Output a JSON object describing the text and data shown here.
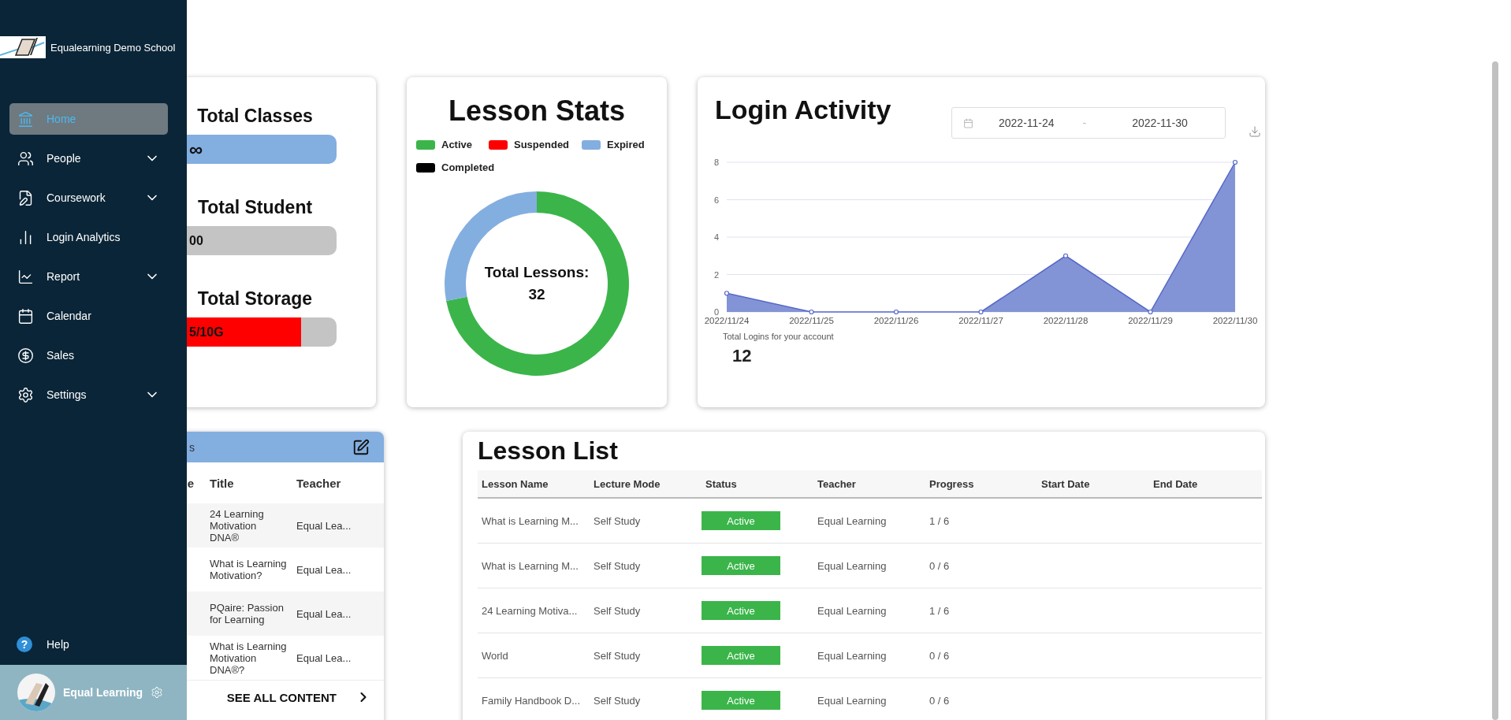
{
  "sidebar": {
    "school_name": "Equalearning Demo School",
    "nav_items": [
      {
        "label": "Home",
        "selected": true,
        "expandable": false
      },
      {
        "label": "People",
        "selected": false,
        "expandable": true
      },
      {
        "label": "Coursework",
        "selected": false,
        "expandable": true
      },
      {
        "label": "Login Analytics",
        "selected": false,
        "expandable": false
      },
      {
        "label": "Report",
        "selected": false,
        "expandable": true
      },
      {
        "label": "Calendar",
        "selected": false,
        "expandable": false
      },
      {
        "label": "Sales",
        "selected": false,
        "expandable": false
      },
      {
        "label": "Settings",
        "selected": false,
        "expandable": true
      }
    ],
    "help_icon": "?",
    "help": "Help",
    "user": {
      "name": "Equal Learning"
    }
  },
  "stats": {
    "items": [
      {
        "title": "Total Classes",
        "value": "∞",
        "color": "#83aee0"
      },
      {
        "title": "Total Student",
        "value": "00",
        "color": "#c4c4c4"
      },
      {
        "title": "Total Storage",
        "value": "5/10G",
        "color": "#ff0000",
        "level": 0.81
      }
    ]
  },
  "lesson_stats": {
    "title": "Lesson Stats",
    "legend": [
      {
        "label": "Active",
        "color": "#3bb54a"
      },
      {
        "label": "Suspended",
        "color": "#ff0000"
      },
      {
        "label": "Expired",
        "color": "#83aee0"
      },
      {
        "label": "Completed",
        "color": "#000000"
      }
    ],
    "center_label": "Total Lessons:",
    "total": "32",
    "chart_data": {
      "type": "donut",
      "values": [
        72,
        0,
        28,
        0
      ]
    }
  },
  "login_activity": {
    "title": "Login Activity",
    "date_range": {
      "start": "2022-11-24",
      "separator": "-",
      "end": "2022-11-30"
    },
    "chart_data": {
      "type": "area",
      "categories": [
        "2022/11/24",
        "2022/11/25",
        "2022/11/26",
        "2022/11/27",
        "2022/11/28",
        "2022/11/29",
        "2022/11/30"
      ],
      "values": [
        1,
        0,
        0,
        0,
        3,
        0,
        8
      ],
      "ylim": [
        0,
        8
      ],
      "grid": true,
      "yticks": [
        0,
        2,
        4,
        6,
        8
      ]
    },
    "total_label": "Total Logins for your account",
    "total": "12"
  },
  "content_table": {
    "title": "s",
    "columns": [
      "e",
      "Title",
      "Teacher"
    ],
    "rows": [
      {
        "title": "24 Learning Motivation DNA®",
        "teacher": "Equal Lea..."
      },
      {
        "title": "What is Learning Motivation?",
        "teacher": "Equal Lea..."
      },
      {
        "title": "PQaire: Passion for Learning",
        "teacher": "Equal Lea..."
      },
      {
        "title": "What is Learning Motivation DNA®?",
        "teacher": "Equal Lea..."
      }
    ],
    "footer": "SEE ALL CONTENT"
  },
  "lesson_list": {
    "title": "Lesson List",
    "columns": [
      "Lesson Name",
      "Lecture Mode",
      "Status",
      "Teacher",
      "Progress",
      "Start Date",
      "End Date"
    ],
    "rows": [
      {
        "lesson_name": "What is Learning M...",
        "lecture_mode": "Self Study",
        "status": "Active",
        "teacher": "Equal Learning",
        "progress": "1 / 6"
      },
      {
        "lesson_name": "What is Learning M...",
        "lecture_mode": "Self Study",
        "status": "Active",
        "teacher": "Equal Learning",
        "progress": "0 / 6"
      },
      {
        "lesson_name": "24 Learning Motiva...",
        "lecture_mode": "Self Study",
        "status": "Active",
        "teacher": "Equal Learning",
        "progress": "1 / 6"
      },
      {
        "lesson_name": "World",
        "lecture_mode": "Self Study",
        "status": "Active",
        "teacher": "Equal Learning",
        "progress": "0 / 6"
      },
      {
        "lesson_name": "Family Handbook D...",
        "lecture_mode": "Self Study",
        "status": "Active",
        "teacher": "Equal Learning",
        "progress": "0 / 6"
      }
    ]
  }
}
